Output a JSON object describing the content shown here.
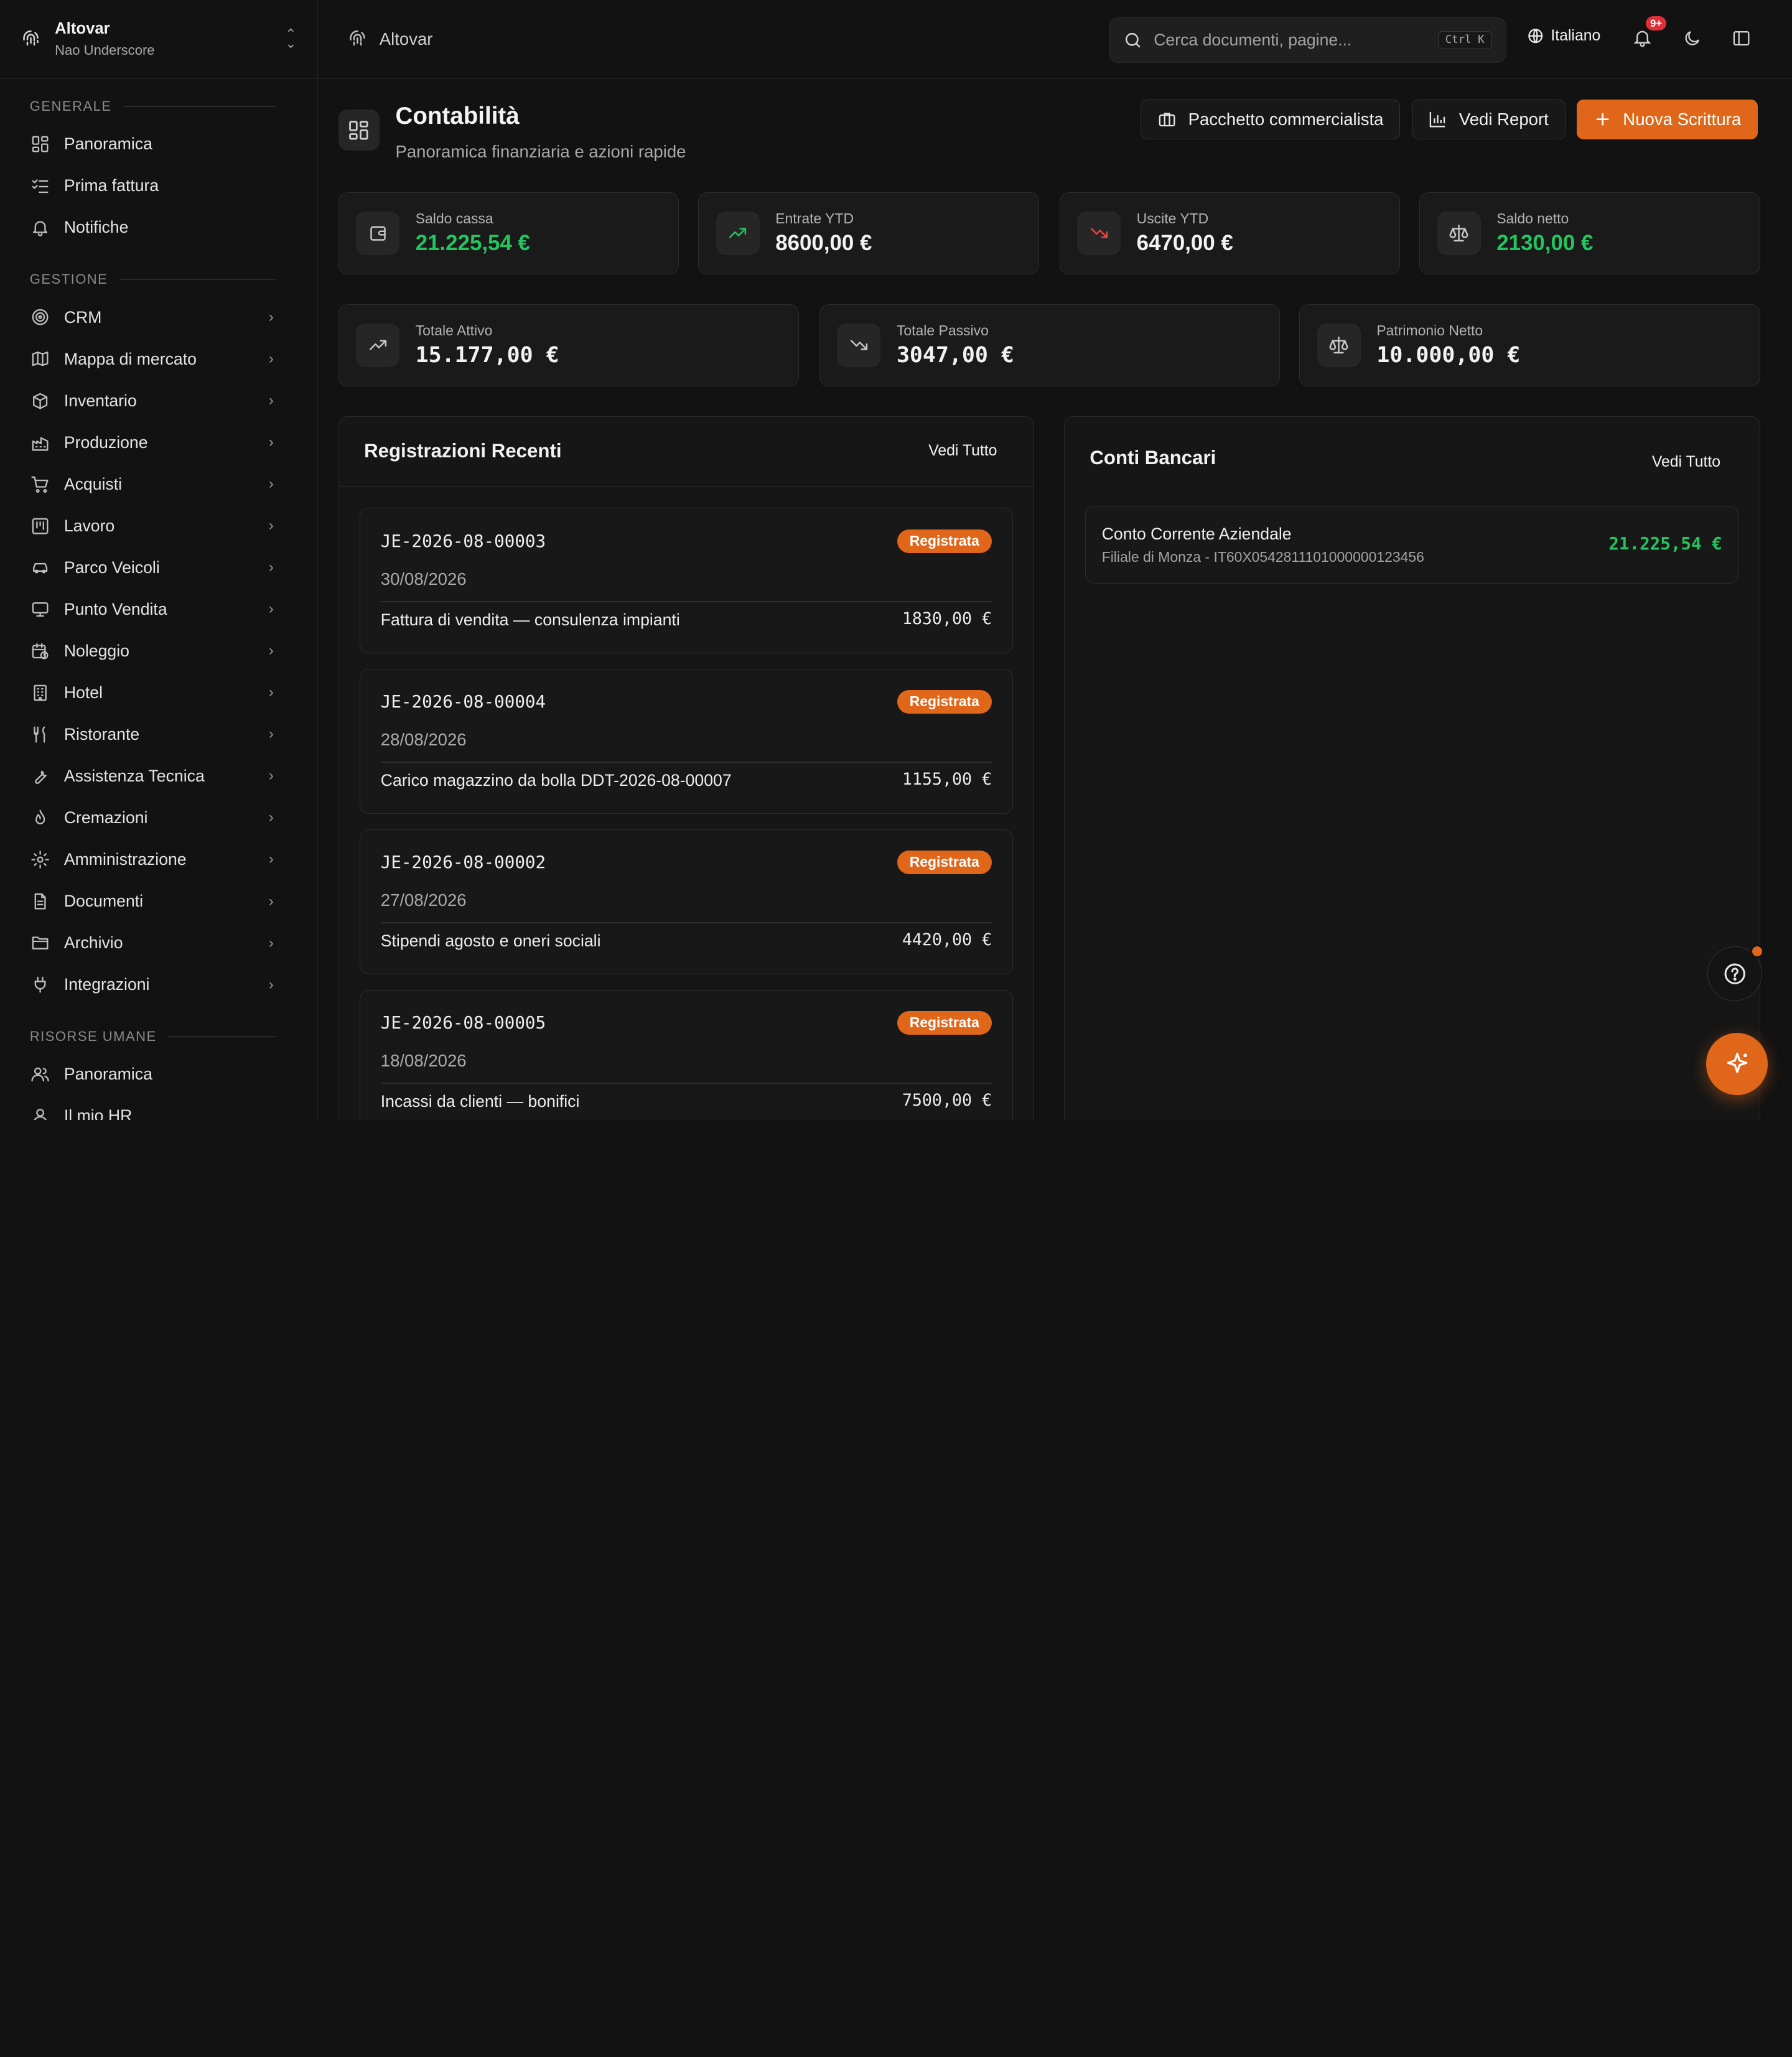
{
  "org": {
    "name": "Altovar",
    "user": "Nao Underscore"
  },
  "sidebar": {
    "sections": [
      {
        "label": "GENERALE",
        "items": [
          {
            "label": "Panoramica",
            "icon": "dashboard-icon",
            "chevron": false
          },
          {
            "label": "Prima fattura",
            "icon": "checklist-icon",
            "chevron": false
          },
          {
            "label": "Notifiche",
            "icon": "bell-icon",
            "chevron": false
          }
        ]
      },
      {
        "label": "GESTIONE",
        "items": [
          {
            "label": "CRM",
            "icon": "target-icon",
            "chevron": true
          },
          {
            "label": "Mappa di mercato",
            "icon": "map-icon",
            "chevron": true
          },
          {
            "label": "Inventario",
            "icon": "package-icon",
            "chevron": true
          },
          {
            "label": "Produzione",
            "icon": "factory-icon",
            "chevron": true
          },
          {
            "label": "Acquisti",
            "icon": "cart-icon",
            "chevron": true
          },
          {
            "label": "Lavoro",
            "icon": "kanban-icon",
            "chevron": true
          },
          {
            "label": "Parco Veicoli",
            "icon": "car-icon",
            "chevron": true
          },
          {
            "label": "Punto Vendita",
            "icon": "monitor-icon",
            "chevron": true
          },
          {
            "label": "Noleggio",
            "icon": "calendar-clock-icon",
            "chevron": true
          },
          {
            "label": "Hotel",
            "icon": "building-icon",
            "chevron": true
          },
          {
            "label": "Ristorante",
            "icon": "utensils-icon",
            "chevron": true
          },
          {
            "label": "Assistenza Tecnica",
            "icon": "wrench-icon",
            "chevron": true
          },
          {
            "label": "Cremazioni",
            "icon": "flame-icon",
            "chevron": true
          },
          {
            "label": "Amministrazione",
            "icon": "gear-icon",
            "chevron": true
          },
          {
            "label": "Documenti",
            "icon": "file-icon",
            "chevron": true
          },
          {
            "label": "Archivio",
            "icon": "folder-icon",
            "chevron": true
          },
          {
            "label": "Integrazioni",
            "icon": "plug-icon",
            "chevron": true
          }
        ]
      },
      {
        "label": "RISORSE UMANE",
        "items": [
          {
            "label": "Panoramica",
            "icon": "users-icon",
            "chevron": false
          },
          {
            "label": "Il mio HR",
            "icon": "user-icon",
            "chevron": false
          }
        ]
      }
    ]
  },
  "topbar": {
    "breadcrumb": "Altovar",
    "search_placeholder": "Cerca documenti, pagine...",
    "shortcut": "Ctrl K",
    "language": "Italiano",
    "notifications_badge": "9+"
  },
  "page": {
    "title": "Contabilità",
    "subtitle": "Panoramica finanziaria e azioni rapide",
    "actions": {
      "accountant": "Pacchetto commercialista",
      "report": "Vedi Report",
      "new_entry": "Nuova Scrittura"
    }
  },
  "stats_top": [
    {
      "label": "Saldo cassa",
      "value": "21.225,54 €",
      "icon": "wallet-icon",
      "color": "#22c55e"
    },
    {
      "label": "Entrate YTD",
      "value": "8600,00 €",
      "icon": "trending-up-icon",
      "color": "#f2f2f2"
    },
    {
      "label": "Uscite YTD",
      "value": "6470,00 €",
      "icon": "trending-down-icon",
      "color": "#f2f2f2"
    },
    {
      "label": "Saldo netto",
      "value": "2130,00 €",
      "icon": "scale-icon",
      "color": "#22c55e"
    }
  ],
  "stats_bottom": [
    {
      "label": "Totale Attivo",
      "value": "15.177,00 €",
      "icon": "trending-up-icon"
    },
    {
      "label": "Totale Passivo",
      "value": "3047,00 €",
      "icon": "trending-down-icon"
    },
    {
      "label": "Patrimonio Netto",
      "value": "10.000,00 €",
      "icon": "scale-icon"
    }
  ],
  "recent": {
    "title": "Registrazioni Recenti",
    "view_all": "Vedi Tutto",
    "entries": [
      {
        "code": "JE-2026-08-00003",
        "status": "Registrata",
        "date": "30/08/2026",
        "description": "Fattura di vendita — consulenza impianti",
        "amount": "1830,00 €"
      },
      {
        "code": "JE-2026-08-00004",
        "status": "Registrata",
        "date": "28/08/2026",
        "description": "Carico magazzino da bolla DDT-2026-08-00007",
        "amount": "1155,00 €"
      },
      {
        "code": "JE-2026-08-00002",
        "status": "Registrata",
        "date": "27/08/2026",
        "description": "Stipendi agosto e oneri sociali",
        "amount": "4420,00 €"
      },
      {
        "code": "JE-2026-08-00005",
        "status": "Registrata",
        "date": "18/08/2026",
        "description": "Incassi da clienti — bonifici",
        "amount": "7500,00 €"
      }
    ]
  },
  "banks": {
    "title": "Conti Bancari",
    "view_all": "Vedi Tutto",
    "accounts": [
      {
        "name": "Conto Corrente Aziendale",
        "detail": "Filiale di Monza - IT60X0542811101000000123456",
        "balance": "21.225,54 €",
        "color": "#22c55e"
      }
    ]
  },
  "colors": {
    "accent": "#e0661a",
    "positive": "#22c55e",
    "negative": "#ef4444"
  }
}
